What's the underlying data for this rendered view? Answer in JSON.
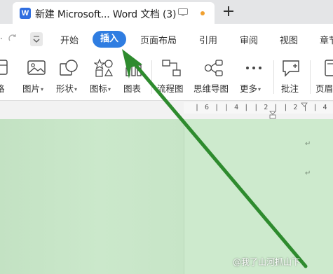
{
  "window": {
    "tab_title": "新建 Microsoft... Word 文档 (3)",
    "word_icon_letter": "W",
    "add_tab_icon": "plus-icon",
    "unsaved_dot_color": "#f0a030"
  },
  "menu": {
    "items": [
      {
        "label": "开始"
      },
      {
        "label": "插入"
      },
      {
        "label": "页面布局"
      },
      {
        "label": "引用"
      },
      {
        "label": "审阅"
      },
      {
        "label": "视图"
      },
      {
        "label": "章节"
      }
    ],
    "active": "插入",
    "active_color": "#2f7de1"
  },
  "ribbon": {
    "tools": [
      {
        "label": "格",
        "has_dropdown": false
      },
      {
        "label": "图片",
        "has_dropdown": true,
        "icon": "picture-icon"
      },
      {
        "label": "形状",
        "has_dropdown": true,
        "icon": "shape-icon"
      },
      {
        "label": "图标",
        "has_dropdown": true,
        "icon": "icons-icon"
      },
      {
        "label": "图表",
        "has_dropdown": false,
        "icon": "chart-icon"
      },
      {
        "label": "流程图",
        "has_dropdown": false,
        "icon": "flowchart-icon"
      },
      {
        "label": "思维导图",
        "has_dropdown": false,
        "icon": "mindmap-icon"
      },
      {
        "label": "更多",
        "has_dropdown": true,
        "icon": "more-icon"
      },
      {
        "label": "批注",
        "has_dropdown": false,
        "icon": "comment-icon"
      },
      {
        "label": "页眉",
        "has_dropdown": false,
        "icon": "header-icon"
      }
    ]
  },
  "ruler": {
    "marks": "| 6 |   | 4 |   | 2 |      | 2 |   | 4 |"
  },
  "document": {
    "background_color": "#cdeacd"
  },
  "annotation": {
    "arrow_color": "#2e8b2e"
  },
  "watermark": {
    "text": "@我了山河抓山下"
  }
}
